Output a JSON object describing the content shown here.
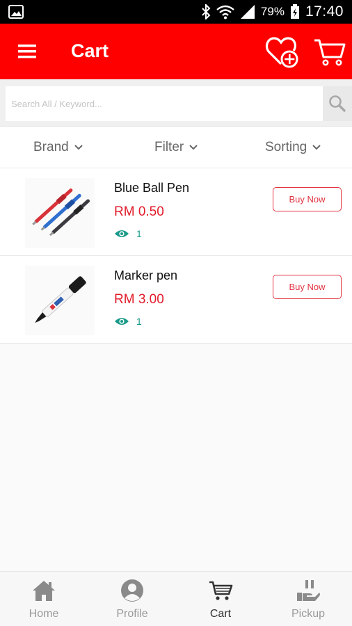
{
  "status_bar": {
    "battery_percent": "79%",
    "time": "17:40",
    "left_icon": "image-notification-icon",
    "right_icons": [
      "bluetooth-icon",
      "wifi-icon",
      "signal-icon",
      "battery-icon"
    ]
  },
  "app_bar": {
    "title": "Cart",
    "background_color": "#ff0000",
    "icons": [
      "menu-icon",
      "wishlist-add-icon",
      "cart-icon"
    ]
  },
  "search": {
    "placeholder": "Search All / Keyword..."
  },
  "filters": {
    "brand": "Brand",
    "filter": "Filter",
    "sorting": "Sorting"
  },
  "products": [
    {
      "name": "Blue Ball Pen",
      "price": "RM 0.50",
      "views": "1",
      "button": "Buy Now",
      "image": "ball-pens-image"
    },
    {
      "name": "Marker pen",
      "price": "RM 3.00",
      "views": "1",
      "button": "Buy Now",
      "image": "marker-pen-image"
    }
  ],
  "bottom_nav": {
    "home": "Home",
    "profile": "Profile",
    "cart": "Cart",
    "pickup": "Pickup",
    "active": "Cart"
  },
  "colors": {
    "accent": "#ff0000",
    "price": "#e21b2a",
    "views": "#1a9a8a"
  }
}
